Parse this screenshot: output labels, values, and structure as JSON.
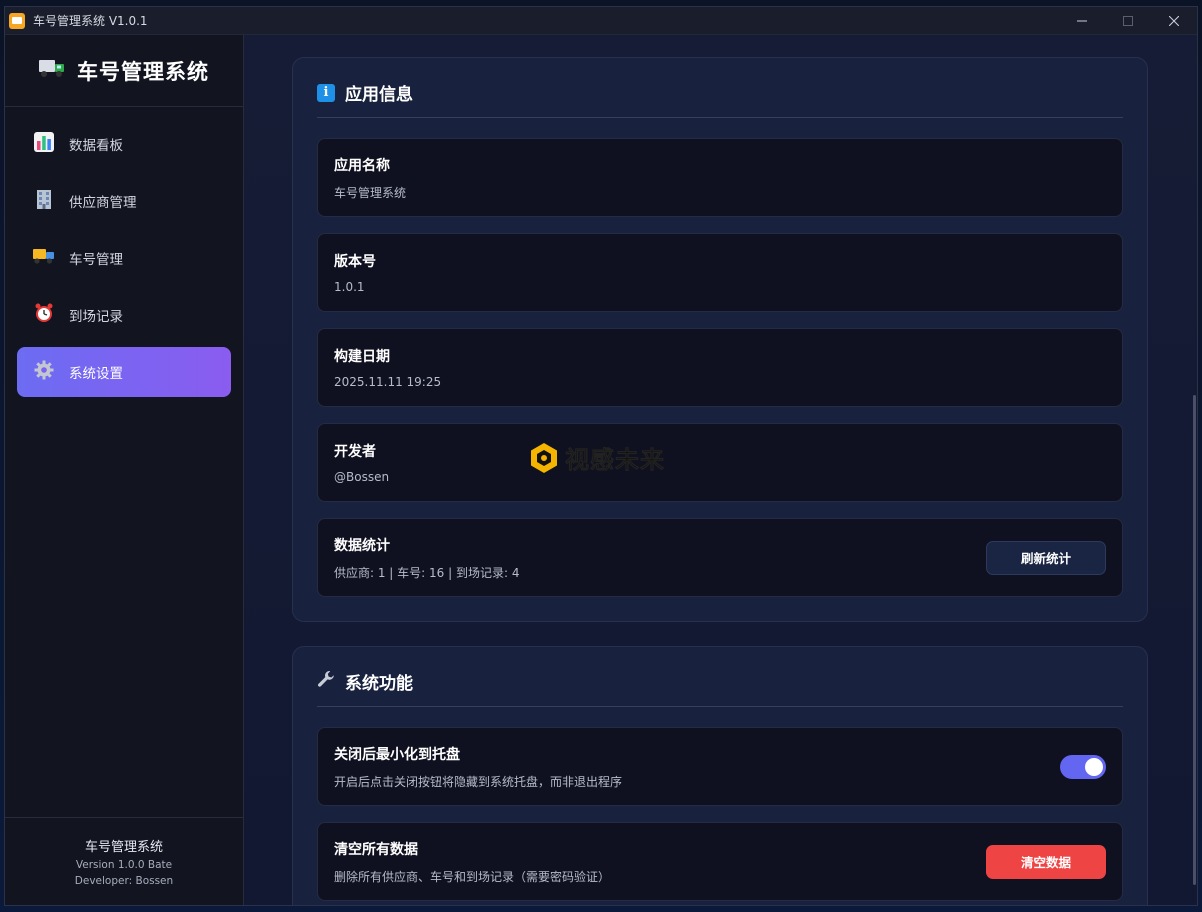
{
  "window": {
    "title": "车号管理系统 V1.0.1",
    "controls": {
      "minimize": "—",
      "maximize": "☐",
      "close": "✕"
    }
  },
  "sidebar": {
    "brand": "车号管理系统",
    "brand_icon": "truck-icon",
    "items": [
      {
        "label": "数据看板",
        "icon": "bar-chart-icon",
        "active": false
      },
      {
        "label": "供应商管理",
        "icon": "building-icon",
        "active": false
      },
      {
        "label": "车号管理",
        "icon": "delivery-truck-icon",
        "active": false
      },
      {
        "label": "到场记录",
        "icon": "alarm-clock-icon",
        "active": false
      },
      {
        "label": "系统设置",
        "icon": "gear-icon",
        "active": true
      }
    ],
    "footer": {
      "name": "车号管理系统",
      "version": "Version 1.0.0 Bate",
      "developer": "Developer: Bossen"
    }
  },
  "app_info": {
    "title": "应用信息",
    "rows": [
      {
        "label": "应用名称",
        "value": "车号管理系统"
      },
      {
        "label": "版本号",
        "value": "1.0.1"
      },
      {
        "label": "构建日期",
        "value": "2025.11.11 19:25"
      },
      {
        "label": "开发者",
        "value": "@Bossen"
      },
      {
        "label": "数据统计",
        "value": "供应商: 1 | 车号: 16 | 到场记录: 4",
        "button": "刷新统计"
      }
    ]
  },
  "system_functions": {
    "title": "系统功能",
    "rows": [
      {
        "label": "关闭后最小化到托盘",
        "value": "开启后点击关闭按钮将隐藏到系统托盘，而非退出程序",
        "toggle_on": true
      },
      {
        "label": "清空所有数据",
        "value": "删除所有供应商、车号和到场记录（需要密码验证）",
        "button": "清空数据"
      }
    ]
  },
  "watermark": {
    "text": "视感未来"
  },
  "colors": {
    "accent": "#6c6cf2",
    "danger": "#ef4444",
    "toggle": "#6366f1"
  }
}
